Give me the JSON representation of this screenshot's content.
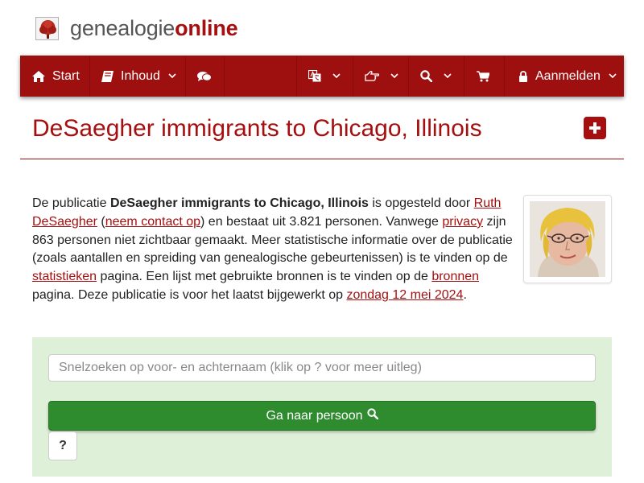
{
  "brand": {
    "name_part1": "genealogie",
    "name_part2": "online",
    "logo_icon": "tree-icon"
  },
  "nav": {
    "start_label": "Start",
    "inhoud_label": "Inhoud",
    "login_label": "Aanmelden",
    "icons": [
      "home-icon",
      "book-icon",
      "comments-icon",
      "language-icon",
      "hand-pointer-icon",
      "search-icon",
      "cart-icon",
      "lock-icon",
      "chevron-down-icon"
    ]
  },
  "page": {
    "title": "DeSaegher immigrants to Chicago, Illinois",
    "add_icon": "plus-square-icon"
  },
  "intro": {
    "t1": "De publicatie ",
    "pub_name": "DeSaegher immigrants to Chicago, Illinois",
    "t2": " is opgesteld door ",
    "author": "Ruth DeSaegher",
    "t3": " (",
    "contact": "neem contact op",
    "t4": ") en bestaat uit 3.821 personen. Vanwege ",
    "privacy": "privacy",
    "t5": " zijn 863 personen niet zichtbaar gemaakt. Meer statistische informatie over de publicatie (zoals aantallen en spreiding van genealogische gebeurtenissen) is te vinden op de ",
    "stats": "statistieken",
    "t6": " pagina. Een lijst met gebruikte bronnen is te vinden op de ",
    "sources": "bronnen",
    "t7": " pagina. Deze publicatie is voor het laatst bijgewerkt op ",
    "updated": "zondag 12 mei 2024",
    "t8": "."
  },
  "search": {
    "placeholder": "Snelzoeken op voor- en achternaam (klik op ? voor meer uitleg)",
    "go_label": "Ga naar persoon",
    "help_label": "?"
  },
  "colors": {
    "brand_red": "#a50f0f",
    "nav_red": "#9e0f0f",
    "panel_green": "#dff0d8",
    "button_green": "#2e8b2e"
  }
}
